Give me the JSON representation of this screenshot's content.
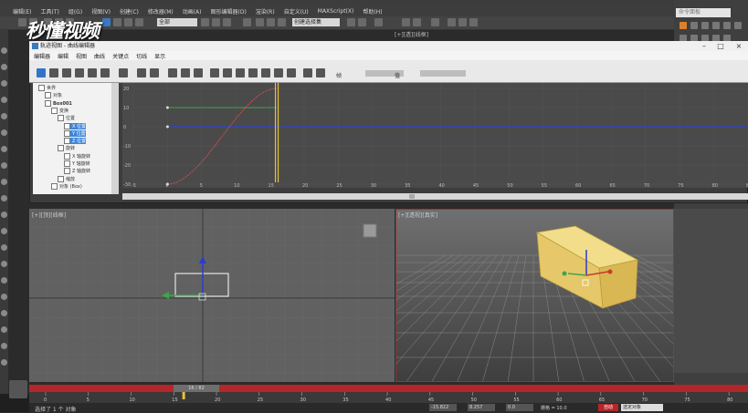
{
  "menubar": [
    "编辑(E)",
    "工具(T)",
    "组(G)",
    "视图(V)",
    "创建(C)",
    "修改器(M)",
    "动画(A)",
    "图形编辑器(D)",
    "渲染(R)",
    "自定义(U)",
    "MAXScript(X)",
    "帮助(H)"
  ],
  "toolbar": {
    "selection_filter": "全部",
    "named_selection": "创建选择集"
  },
  "viewport_top_label": "[+][透][线框]",
  "search_placeholder": "命令面板",
  "watermark": "秒懂视频",
  "curve_editor": {
    "title": "轨迹视图 - 曲线编辑器",
    "menu": [
      "编辑器",
      "编辑",
      "视图",
      "曲线",
      "关键点",
      "切线",
      "显示"
    ],
    "field1_label": "帧",
    "field2_label": "值",
    "tree": [
      {
        "label": "世界",
        "indent": 0,
        "selected": false,
        "bold": false
      },
      {
        "label": "对象",
        "indent": 1,
        "selected": false,
        "bold": false
      },
      {
        "label": "Box001",
        "indent": 1,
        "selected": false,
        "bold": true
      },
      {
        "label": "变换",
        "indent": 2,
        "selected": false,
        "bold": false
      },
      {
        "label": "位置",
        "indent": 3,
        "selected": false,
        "bold": false
      },
      {
        "label": "X 位置",
        "indent": 4,
        "selected": true,
        "bold": false
      },
      {
        "label": "Y 位置",
        "indent": 4,
        "selected": true,
        "bold": false
      },
      {
        "label": "Z 位置",
        "indent": 4,
        "selected": true,
        "bold": false
      },
      {
        "label": "旋转",
        "indent": 3,
        "selected": false,
        "bold": false
      },
      {
        "label": "X 轴旋转",
        "indent": 4,
        "selected": false,
        "bold": false
      },
      {
        "label": "Y 轴旋转",
        "indent": 4,
        "selected": false,
        "bold": false
      },
      {
        "label": "Z 轴旋转",
        "indent": 4,
        "selected": false,
        "bold": false
      },
      {
        "label": "缩放",
        "indent": 3,
        "selected": false,
        "bold": false
      },
      {
        "label": "对象 (Box)",
        "indent": 2,
        "selected": false,
        "bold": false
      }
    ],
    "y_ticks": [
      "20",
      "10",
      "0",
      "-10",
      "-20",
      "-30"
    ],
    "x_ticks": [
      "-5",
      "0",
      "5",
      "10",
      "15",
      "20",
      "25",
      "30",
      "35",
      "40",
      "45",
      "50",
      "55",
      "60",
      "65",
      "70",
      "75",
      "80",
      "85"
    ],
    "current_frame": 16
  },
  "viewports": {
    "left_label": "[+][顶][线框]",
    "right_label": "[+][透视][真实]"
  },
  "timeline": {
    "slider_label": "16 / 82",
    "ticks": [
      "0",
      "5",
      "10",
      "15",
      "20",
      "25",
      "30",
      "35",
      "40",
      "45",
      "50",
      "55",
      "60",
      "65",
      "70",
      "75",
      "80"
    ]
  },
  "status": {
    "text": "选择了 1 个 对象",
    "x": "-15.822",
    "y": "8.257",
    "z": "0.0",
    "grid": "栅格 = 10.0",
    "autokey": "自动",
    "selection_set": "选定对象"
  },
  "colors": {
    "accent_red": "#b3262a",
    "selection_blue": "#3d86d9",
    "curve_blue": "#3344cc",
    "curve_green": "#3da64a",
    "curve_red": "#c85050",
    "time_marker": "#e8c23a",
    "box_yellow": "#e8d27a"
  }
}
